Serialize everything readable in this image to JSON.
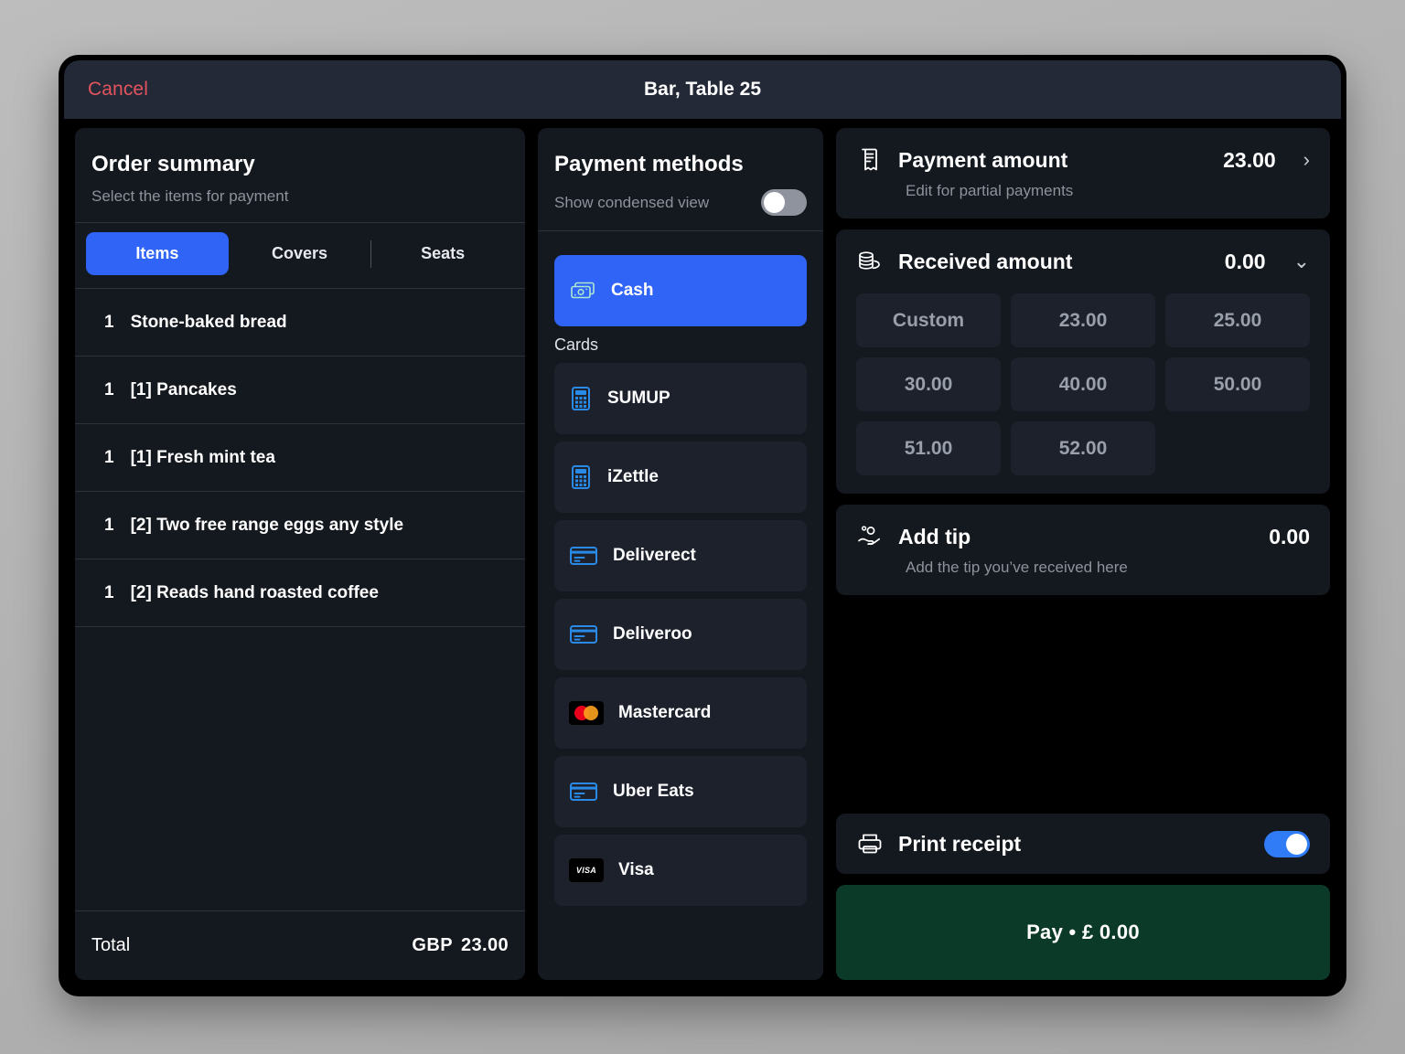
{
  "topbar": {
    "cancel_label": "Cancel",
    "title": "Bar, Table 25"
  },
  "order_summary": {
    "title": "Order summary",
    "subtitle": "Select the items for payment",
    "tabs": [
      {
        "label": "Items",
        "active": true
      },
      {
        "label": "Covers",
        "active": false
      },
      {
        "label": "Seats",
        "active": false
      }
    ],
    "items": [
      {
        "qty": "1",
        "name": "Stone-baked bread"
      },
      {
        "qty": "1",
        "name": "[1] Pancakes"
      },
      {
        "qty": "1",
        "name": "[1] Fresh mint tea"
      },
      {
        "qty": "1",
        "name": "[2] Two free range eggs any style"
      },
      {
        "qty": "1",
        "name": "[2] Reads hand roasted coffee"
      }
    ],
    "total_label": "Total",
    "total_currency": "GBP",
    "total_value": "23.00"
  },
  "payment_methods": {
    "title": "Payment methods",
    "condensed_label": "Show condensed view",
    "condensed_on": false,
    "cash": {
      "label": "Cash",
      "icon": "banknote-icon",
      "selected": true
    },
    "cards_group_label": "Cards",
    "cards": [
      {
        "label": "SUMUP",
        "icon": "card-terminal-icon"
      },
      {
        "label": "iZettle",
        "icon": "card-terminal-icon"
      },
      {
        "label": "Deliverect",
        "icon": "credit-card-icon"
      },
      {
        "label": "Deliveroo",
        "icon": "credit-card-icon"
      },
      {
        "label": "Mastercard",
        "icon": "mastercard-icon"
      },
      {
        "label": "Uber Eats",
        "icon": "credit-card-icon"
      },
      {
        "label": "Visa",
        "icon": "visa-icon"
      }
    ]
  },
  "payment_amount": {
    "icon": "receipt-icon",
    "title": "Payment amount",
    "value": "23.00",
    "subtitle": "Edit for partial payments",
    "chevron": "›"
  },
  "received_amount": {
    "icon": "coins-icon",
    "title": "Received amount",
    "value": "0.00",
    "chevron": "⌄",
    "quick_amounts": [
      "Custom",
      "23.00",
      "25.00",
      "30.00",
      "40.00",
      "50.00",
      "51.00",
      "52.00"
    ]
  },
  "add_tip": {
    "icon": "hand-coins-icon",
    "title": "Add tip",
    "value": "0.00",
    "subtitle": "Add the tip you’ve received here"
  },
  "print_receipt": {
    "icon": "printer-icon",
    "label": "Print receipt",
    "on": true
  },
  "pay_button": {
    "label": "Pay • £ 0.00"
  },
  "colors": {
    "accent_blue": "#2f64f6",
    "cancel_red": "#e4545f",
    "pay_green": "#0c3a28",
    "card_bg": "#14181f",
    "tile_bg": "#1c212c",
    "topbar_bg": "#232936"
  }
}
